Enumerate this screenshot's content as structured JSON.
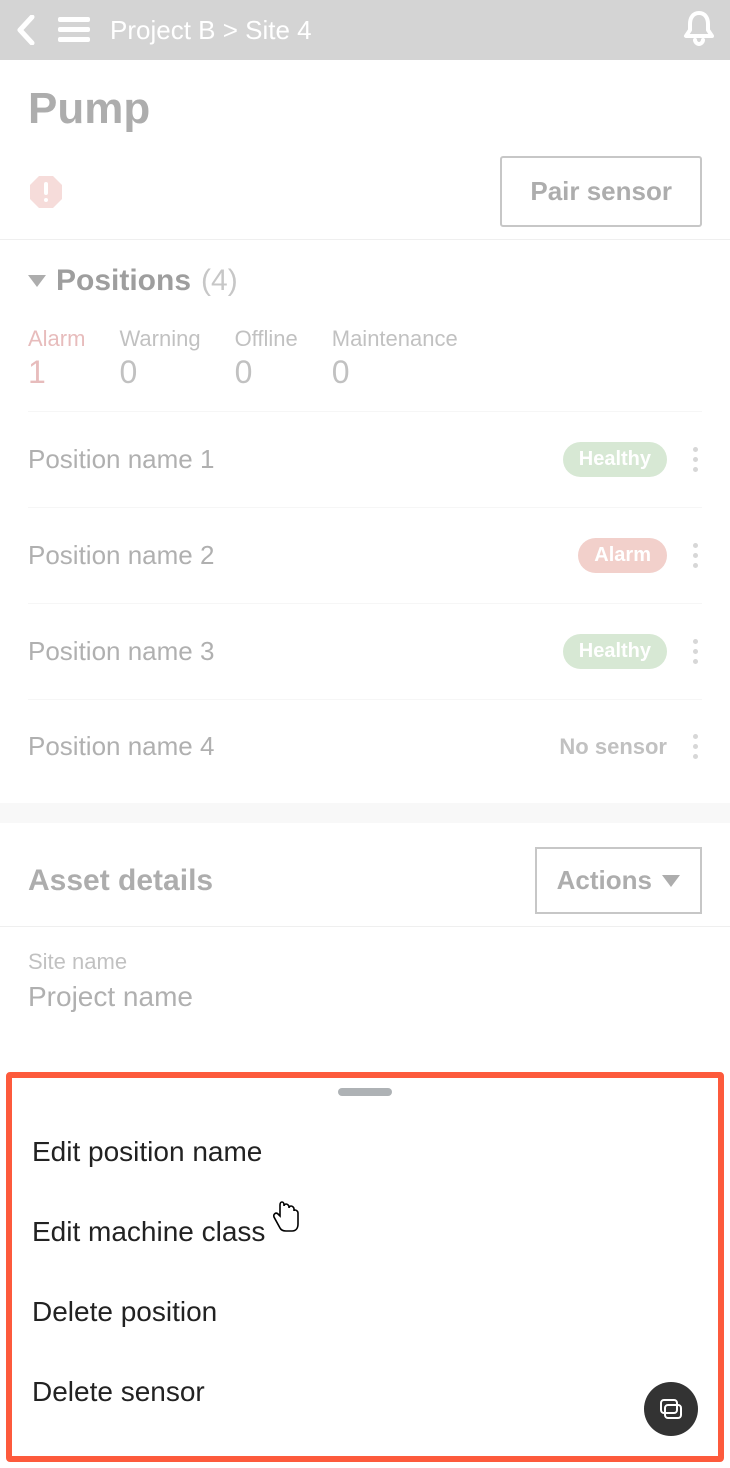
{
  "header": {
    "breadcrumb": "Project B > Site 4"
  },
  "title": {
    "page_title": "Pump",
    "pair_button": "Pair sensor"
  },
  "positions": {
    "section_label": "Positions",
    "count_text": "(4)",
    "status": {
      "alarm": {
        "label": "Alarm",
        "value": "1"
      },
      "warning": {
        "label": "Warning",
        "value": "0"
      },
      "offline": {
        "label": "Offline",
        "value": "0"
      },
      "maint": {
        "label": "Maintenance",
        "value": "0"
      }
    },
    "items": [
      {
        "name": "Position name 1",
        "badge": "Healthy",
        "badge_type": "healthy"
      },
      {
        "name": "Position name 2",
        "badge": "Alarm",
        "badge_type": "alarm"
      },
      {
        "name": "Position name 3",
        "badge": "Healthy",
        "badge_type": "healthy"
      },
      {
        "name": "Position name 4",
        "badge": "No sensor",
        "badge_type": "nosensor"
      }
    ]
  },
  "asset_details": {
    "title": "Asset details",
    "actions_button": "Actions",
    "site_label": "Site name",
    "site_value": "Project name"
  },
  "sheet": {
    "item1": "Edit position name",
    "item2": "Edit machine class",
    "item3": "Delete position",
    "item4": "Delete sensor"
  }
}
